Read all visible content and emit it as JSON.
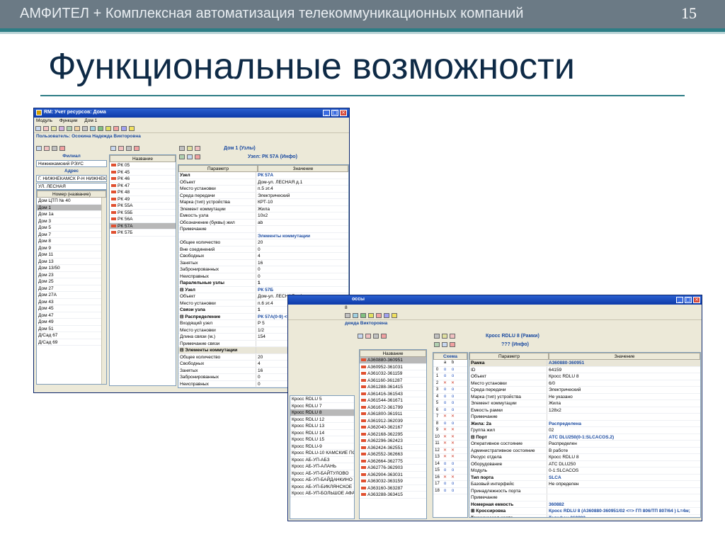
{
  "header": {
    "title": "АМФИТЕЛ + Комплексная автоматизация телекоммуникационных компаний",
    "page": "15"
  },
  "slide_title": "Функциональные возможности",
  "window1": {
    "title": "RM: Учет ресурсов: Дома",
    "menu": [
      "Модуль",
      "Функции",
      "Дом 1"
    ],
    "user": "Пользователь: Осокина Надежда Викторовна",
    "filter": {
      "label": "Филиал",
      "value": "Нижнекамский РЭУС",
      "address_label": "Адрес",
      "address1": "Г. НИЖНЕКАМСК Р-Н НИЖНЕКА",
      "address2": "УЛ. ЛЕСНАЯ"
    },
    "houses_header": "Номер (название)",
    "houses": [
      "Дом ЦТП № 40",
      "Дом 1",
      "Дом 1а",
      "Дом 3",
      "Дом 5",
      "Дом 7",
      "Дом 8",
      "Дом 9",
      "Дом 11",
      "Дом 13",
      "Дом 13/50",
      "Дом 23",
      "Дом 25",
      "Дом 27",
      "Дом 27А",
      "Дом 43",
      "Дом 45",
      "Дом 47",
      "Дом 49",
      "Дом 51",
      "Д/Сад 67",
      "Д/Сад 69"
    ],
    "nodes_header": "Название",
    "nodes": [
      "РК 05",
      "РК 45",
      "РК 46",
      "РК 47",
      "РК 48",
      "РК 49",
      "РК 55А",
      "РК 55Б",
      "РК 56А",
      "РК 57А",
      "РК 57Б"
    ],
    "detail_title": "Дом 1 (Узлы)",
    "node_title": "Узел: РК 57А (Инфо)",
    "col_param": "Параметр",
    "col_value": "Значение",
    "props": [
      [
        "Узел",
        "РК 57А"
      ],
      [
        "Объект",
        "Дом-ул. ЛЕСНАЯ д.1"
      ],
      [
        "Место установки",
        "п.5 эт.4"
      ],
      [
        "Среда передачи",
        "Электрический"
      ],
      [
        "Марка (тип) устройства",
        "КРТ-10"
      ],
      [
        "Элемент коммутации",
        "Жила"
      ],
      [
        "Емкость узла",
        "10х2"
      ],
      [
        "Обозначение (буквы) жил",
        "ab"
      ],
      [
        "Примечание",
        ""
      ],
      [
        "",
        "Элементы коммутации"
      ],
      [
        "Общее количество",
        "20"
      ],
      [
        "Вне соединений",
        "0"
      ],
      [
        "Свободных",
        "4"
      ],
      [
        "Занятых",
        "16"
      ],
      [
        "Забронированных",
        "0"
      ],
      [
        "Неисправных",
        "0"
      ],
      [
        "Паралельные узлы",
        "1"
      ],
      [
        "⊟ Узел",
        "РК 57Б"
      ],
      [
        "Объект",
        "Дом-ул. ЛЕСНАЯ д.1"
      ],
      [
        "Место установки",
        "п.6 эт.4"
      ],
      [
        "Связи узла",
        "1"
      ],
      [
        "⊟ Распределение",
        "РК 57А(0-9) <=> Р 5(70-79) РШ 4207"
      ],
      [
        "Входящий узел",
        "Р 5"
      ],
      [
        "Место установки",
        "1/2"
      ],
      [
        "Длина связи (м.)",
        "154"
      ],
      [
        "Примечание связи",
        ""
      ],
      [
        "⊟ Элементы коммутации",
        ""
      ],
      [
        "Общее количество",
        "20"
      ],
      [
        "Свободных",
        "4"
      ],
      [
        "Занятых",
        "16"
      ],
      [
        "Забронированных",
        "0"
      ],
      [
        "Неисправных",
        "0"
      ]
    ]
  },
  "window2": {
    "title": "оссы",
    "title_suffix": "8",
    "user": "дежда Викторовна",
    "detail_title": "Кросс RDLU 8 (Рамки)",
    "frame_title": "??? (Инфо)",
    "names_header": "Название",
    "frames": [
      "А360880-360951",
      "А360952-361031",
      "А361032-361159",
      "А361160-361287",
      "А361288-361415",
      "А361416-361543",
      "А361544-361671",
      "А361672-361799",
      "А361800-361911",
      "А361912-362039",
      "А362040-362167",
      "А362168-362295",
      "А362296-362423",
      "А362424-362551",
      "А362552-362663",
      "А362664-362775",
      "А362776-362903",
      "А362904-363031",
      "А363032-363159",
      "А363160-363287",
      "А363288-363415"
    ],
    "crosses": [
      "Кросс RDLU 5",
      "Кросс RDLU 7",
      "Кросс RDLU 8",
      "Кросс RDLU 12",
      "Кросс RDLU 13",
      "Кросс RDLU 14",
      "Кросс RDLU 15",
      "Кросс RDLU-9",
      "Кросс RDLU-10 КАМСКИЕ ПОЛ",
      "Кросс АБ-УП-АБЗ",
      "Кросс АБ-УП-АЛАНЬ",
      "Кросс АБ-УП-БАЙТУЛОВО",
      "Кросс АБ-УП-БАЙДАНКИНО",
      "Кросс АБ-УП-БИКЛЯНСКОЕ",
      "Кросс АБ-УП-БОЛЬШОЕ АФАН"
    ],
    "scheme_label": "Схема",
    "scheme_cols": [
      "a",
      "b"
    ],
    "scheme_rows": [
      [
        "0",
        "o",
        "o"
      ],
      [
        "1",
        "o",
        "o"
      ],
      [
        "2",
        "x",
        "x"
      ],
      [
        "3",
        "o",
        "o"
      ],
      [
        "4",
        "o",
        "o"
      ],
      [
        "5",
        "o",
        "o"
      ],
      [
        "6",
        "o",
        "o"
      ],
      [
        "7",
        "x",
        "x"
      ],
      [
        "8",
        "o",
        "o"
      ],
      [
        "9",
        "x",
        "x"
      ],
      [
        "10",
        "x",
        "x"
      ],
      [
        "11",
        "x",
        "x"
      ],
      [
        "12",
        "x",
        "x"
      ],
      [
        "13",
        "x",
        "x"
      ],
      [
        "14",
        "o",
        "o"
      ],
      [
        "15",
        "o",
        "o"
      ],
      [
        "16",
        "x",
        "x"
      ],
      [
        "17",
        "o",
        "o"
      ],
      [
        "18",
        "o",
        "o"
      ]
    ],
    "col_param": "Параметр",
    "col_value": "Значение",
    "props": [
      [
        "Рамка",
        "А360880-360951"
      ],
      [
        "ID",
        "64159"
      ],
      [
        "Объект",
        "Кросс RDLU 8"
      ],
      [
        "Место установки",
        "6/0"
      ],
      [
        "Среда передачи",
        "Электрический"
      ],
      [
        "Марка (тип) устройства",
        "Не указано"
      ],
      [
        "Элемент коммутации",
        "Жила"
      ],
      [
        "Емкость рамки",
        "128х2"
      ],
      [
        "Примечание",
        ""
      ],
      [
        "Жила: 2а",
        "Распределена"
      ],
      [
        "Группа жил",
        "02"
      ],
      [
        "⊟ Порт",
        "АТС DLU250(0-1:SLCACOS.2)"
      ],
      [
        "Оперативное состояние",
        "Распределен"
      ],
      [
        "Административное состояние",
        "В работе"
      ],
      [
        "Ресурс отдела",
        "Кросс RDLU 8"
      ],
      [
        "Оборудование",
        "АТС DLU250"
      ],
      [
        "Модуль",
        "0-1:SLCACOS"
      ],
      [
        "Тип порта",
        "SLCA"
      ],
      [
        "Базовый интерфейс",
        "Не определен"
      ],
      [
        "Принадлежность порта",
        ""
      ],
      [
        "Примечание",
        ""
      ],
      [
        "Номерная емкость",
        "360882"
      ],
      [
        "⊞ Кроссировка",
        "Кросс RDLU 8 (А360880-360951/02 <=> ГП 806/ТП 807/64 ) L=4м;"
      ],
      [
        "Техническая карта",
        "Телефон 360882"
      ]
    ]
  }
}
